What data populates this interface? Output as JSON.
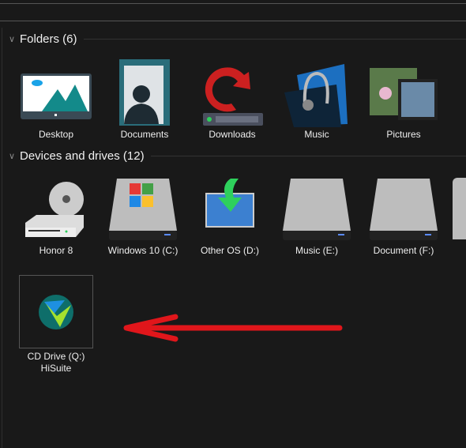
{
  "folders": {
    "title": "Folders (6)",
    "items": [
      {
        "label": "Desktop"
      },
      {
        "label": "Documents"
      },
      {
        "label": "Downloads"
      },
      {
        "label": "Music"
      },
      {
        "label": "Pictures"
      }
    ]
  },
  "drives": {
    "title": "Devices and drives (12)",
    "items": [
      {
        "label": "Honor 8"
      },
      {
        "label": "Windows 10 (C:)"
      },
      {
        "label": "Other OS (D:)"
      },
      {
        "label": "Music (E:)"
      },
      {
        "label": "Document (F:)"
      }
    ],
    "selected": {
      "line1": "CD Drive (Q:)",
      "line2": "HiSuite"
    }
  },
  "annotation": {
    "arrow_color": "#e0161b",
    "direction": "left"
  }
}
